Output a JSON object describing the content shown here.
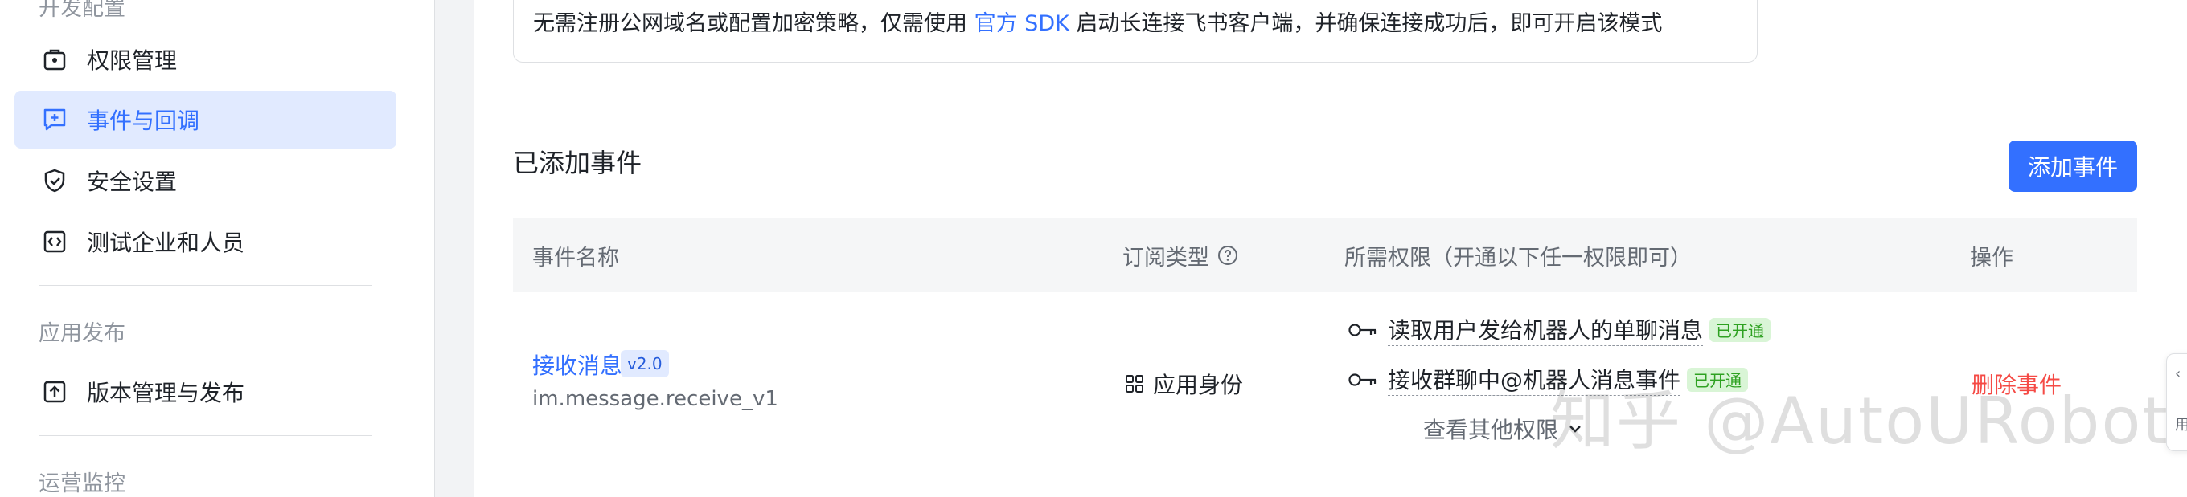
{
  "sidebar": {
    "top_section_label": "开发配置",
    "items": [
      {
        "label": "权限管理",
        "icon": "permission-icon",
        "active": false
      },
      {
        "label": "事件与回调",
        "icon": "event-callback-icon",
        "active": true
      },
      {
        "label": "安全设置",
        "icon": "shield-check-icon",
        "active": false
      },
      {
        "label": "测试企业和人员",
        "icon": "code-icon",
        "active": false
      }
    ],
    "publish_section_label": "应用发布",
    "publish_items": [
      {
        "label": "版本管理与发布",
        "icon": "upload-icon"
      }
    ],
    "ops_section_label": "运营监控"
  },
  "notice": {
    "text_before": "无需注册公网域名或配置加密策略，仅需使用 ",
    "link_text": "官方 SDK",
    "text_after": " 启动长连接飞书客户端，并确保连接成功后，即可开启该模式"
  },
  "events": {
    "title": "已添加事件",
    "add_button": "添加事件",
    "columns": {
      "name": "事件名称",
      "sub_type": "订阅类型",
      "permissions": "所需权限（开通以下任一权限即可）",
      "actions": "操作"
    },
    "rows": [
      {
        "name": "接收消息",
        "version": "v2.0",
        "code": "im.message.receive_v1",
        "sub_type": "应用身份",
        "permissions": [
          {
            "text": "读取用户发给机器人的单聊消息",
            "status": "已开通"
          },
          {
            "text": "接收群聊中@机器人消息事件",
            "status": "已开通"
          }
        ],
        "more_permissions": "查看其他权限",
        "delete_action": "删除事件"
      }
    ]
  },
  "watermark": "知乎 @AutoURobot",
  "right_tab": {
    "line1": "‹",
    "line2": "用"
  },
  "colors": {
    "accent": "#3370ff",
    "active_bg": "#e1eaff",
    "danger": "#f54a45",
    "success": "#2ea121",
    "success_bg": "#d9f5d6"
  }
}
